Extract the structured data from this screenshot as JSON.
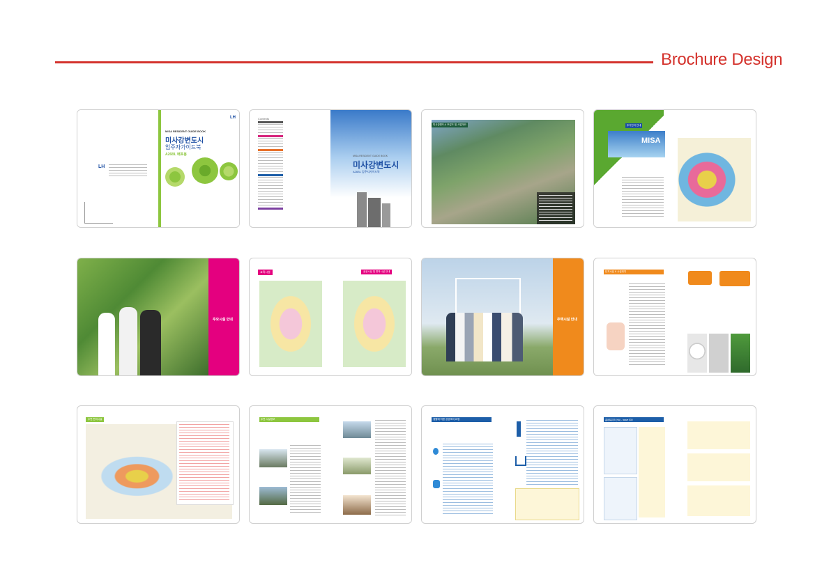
{
  "header": {
    "title": "Brochure Design",
    "accent_color": "#d4322c"
  },
  "spreads": [
    {
      "id": 1,
      "desc": "cover",
      "brand": "LH",
      "cover_en": "MISA RESIDENT GUIDE BOOK",
      "cover_ko_1": "미사강변도시",
      "cover_ko_2": "입주자가이드북",
      "cover_sub": "A26BL 배포용"
    },
    {
      "id": 2,
      "desc": "contents",
      "contents_label": "Contents",
      "cover_en": "MISA RESIDENT GUIDE BOOK",
      "cover_ko": "미사강변도시",
      "cover_sub": "A26BL 입주자가이드북"
    },
    {
      "id": 3,
      "desc": "aerial map",
      "label": "미사강변도시 조감도 및 사업개요"
    },
    {
      "id": 4,
      "desc": "land use",
      "label": "주거단지 안내",
      "misa": "MISA"
    },
    {
      "id": 5,
      "desc": "students photo",
      "section": "주요시설 안내"
    },
    {
      "id": 6,
      "desc": "facility maps",
      "label_left": "교육시설",
      "label_right": "공공시설 및 편의시설 안내"
    },
    {
      "id": 7,
      "desc": "family photo",
      "section": "주택시설 안내"
    },
    {
      "id": 8,
      "desc": "facility details",
      "label": "단지시설 & 시설위치"
    },
    {
      "id": 9,
      "desc": "area map",
      "label": "주변 편의시설"
    },
    {
      "id": 10,
      "desc": "surroundings",
      "label": "주변 시설정보"
    },
    {
      "id": 11,
      "desc": "maintenance",
      "label": "생활에 따른 공공조치 요령"
    },
    {
      "id": 12,
      "desc": "home network",
      "label": "홈네트워크 (HA) - Iwave 530"
    }
  ]
}
